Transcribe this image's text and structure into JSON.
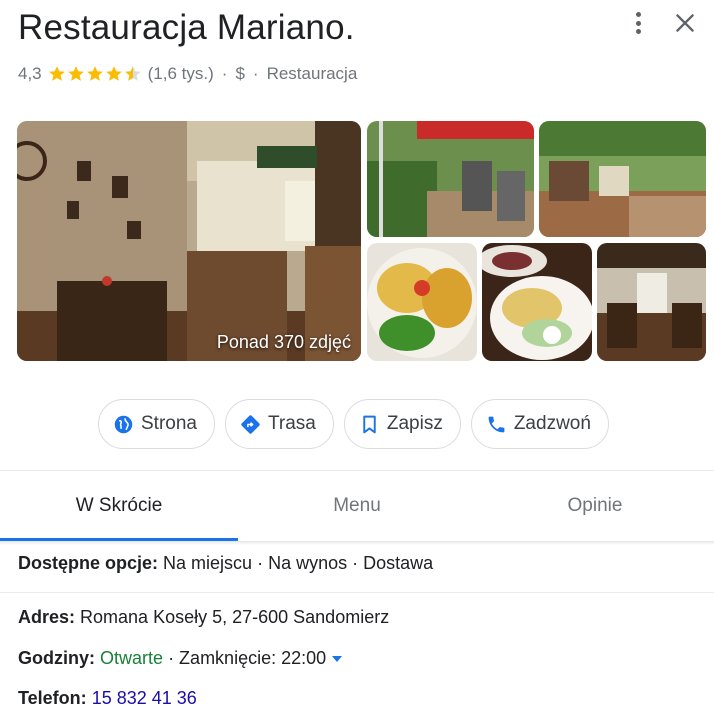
{
  "header": {
    "title": "Restauracja Mariano.",
    "rating": "4,3",
    "stars": 4.3,
    "reviews": "(1,6 tys.)",
    "dot1": "·",
    "price": "$",
    "dot2": "·",
    "category": "Restauracja"
  },
  "photos": {
    "count_label": "Ponad 370 zdjęć"
  },
  "actions": [
    {
      "label": "Strona",
      "icon": "globe-icon"
    },
    {
      "label": "Trasa",
      "icon": "directions-icon"
    },
    {
      "label": "Zapisz",
      "icon": "bookmark-icon"
    },
    {
      "label": "Zadzwoń",
      "icon": "phone-icon"
    }
  ],
  "tabs": [
    {
      "label": "W Skrócie",
      "active": true
    },
    {
      "label": "Menu",
      "active": false
    },
    {
      "label": "Opinie",
      "active": false
    }
  ],
  "info": {
    "options_label": "Dostępne opcje:",
    "options_value": "Na miejscu · Na wynos · Dostawa",
    "address_label": "Adres:",
    "address_value": "Romana Koseły 5, 27-600 Sandomierz",
    "hours_label": "Godziny:",
    "hours_status": "Otwarte",
    "hours_rest": "· Zamknięcie: 22:00",
    "phone_label": "Telefon:",
    "phone_value": "15 832 41 36"
  },
  "colors": {
    "accent": "#1a73e8",
    "star": "#fbbc04",
    "open": "#188038",
    "link": "#1a0dab"
  }
}
